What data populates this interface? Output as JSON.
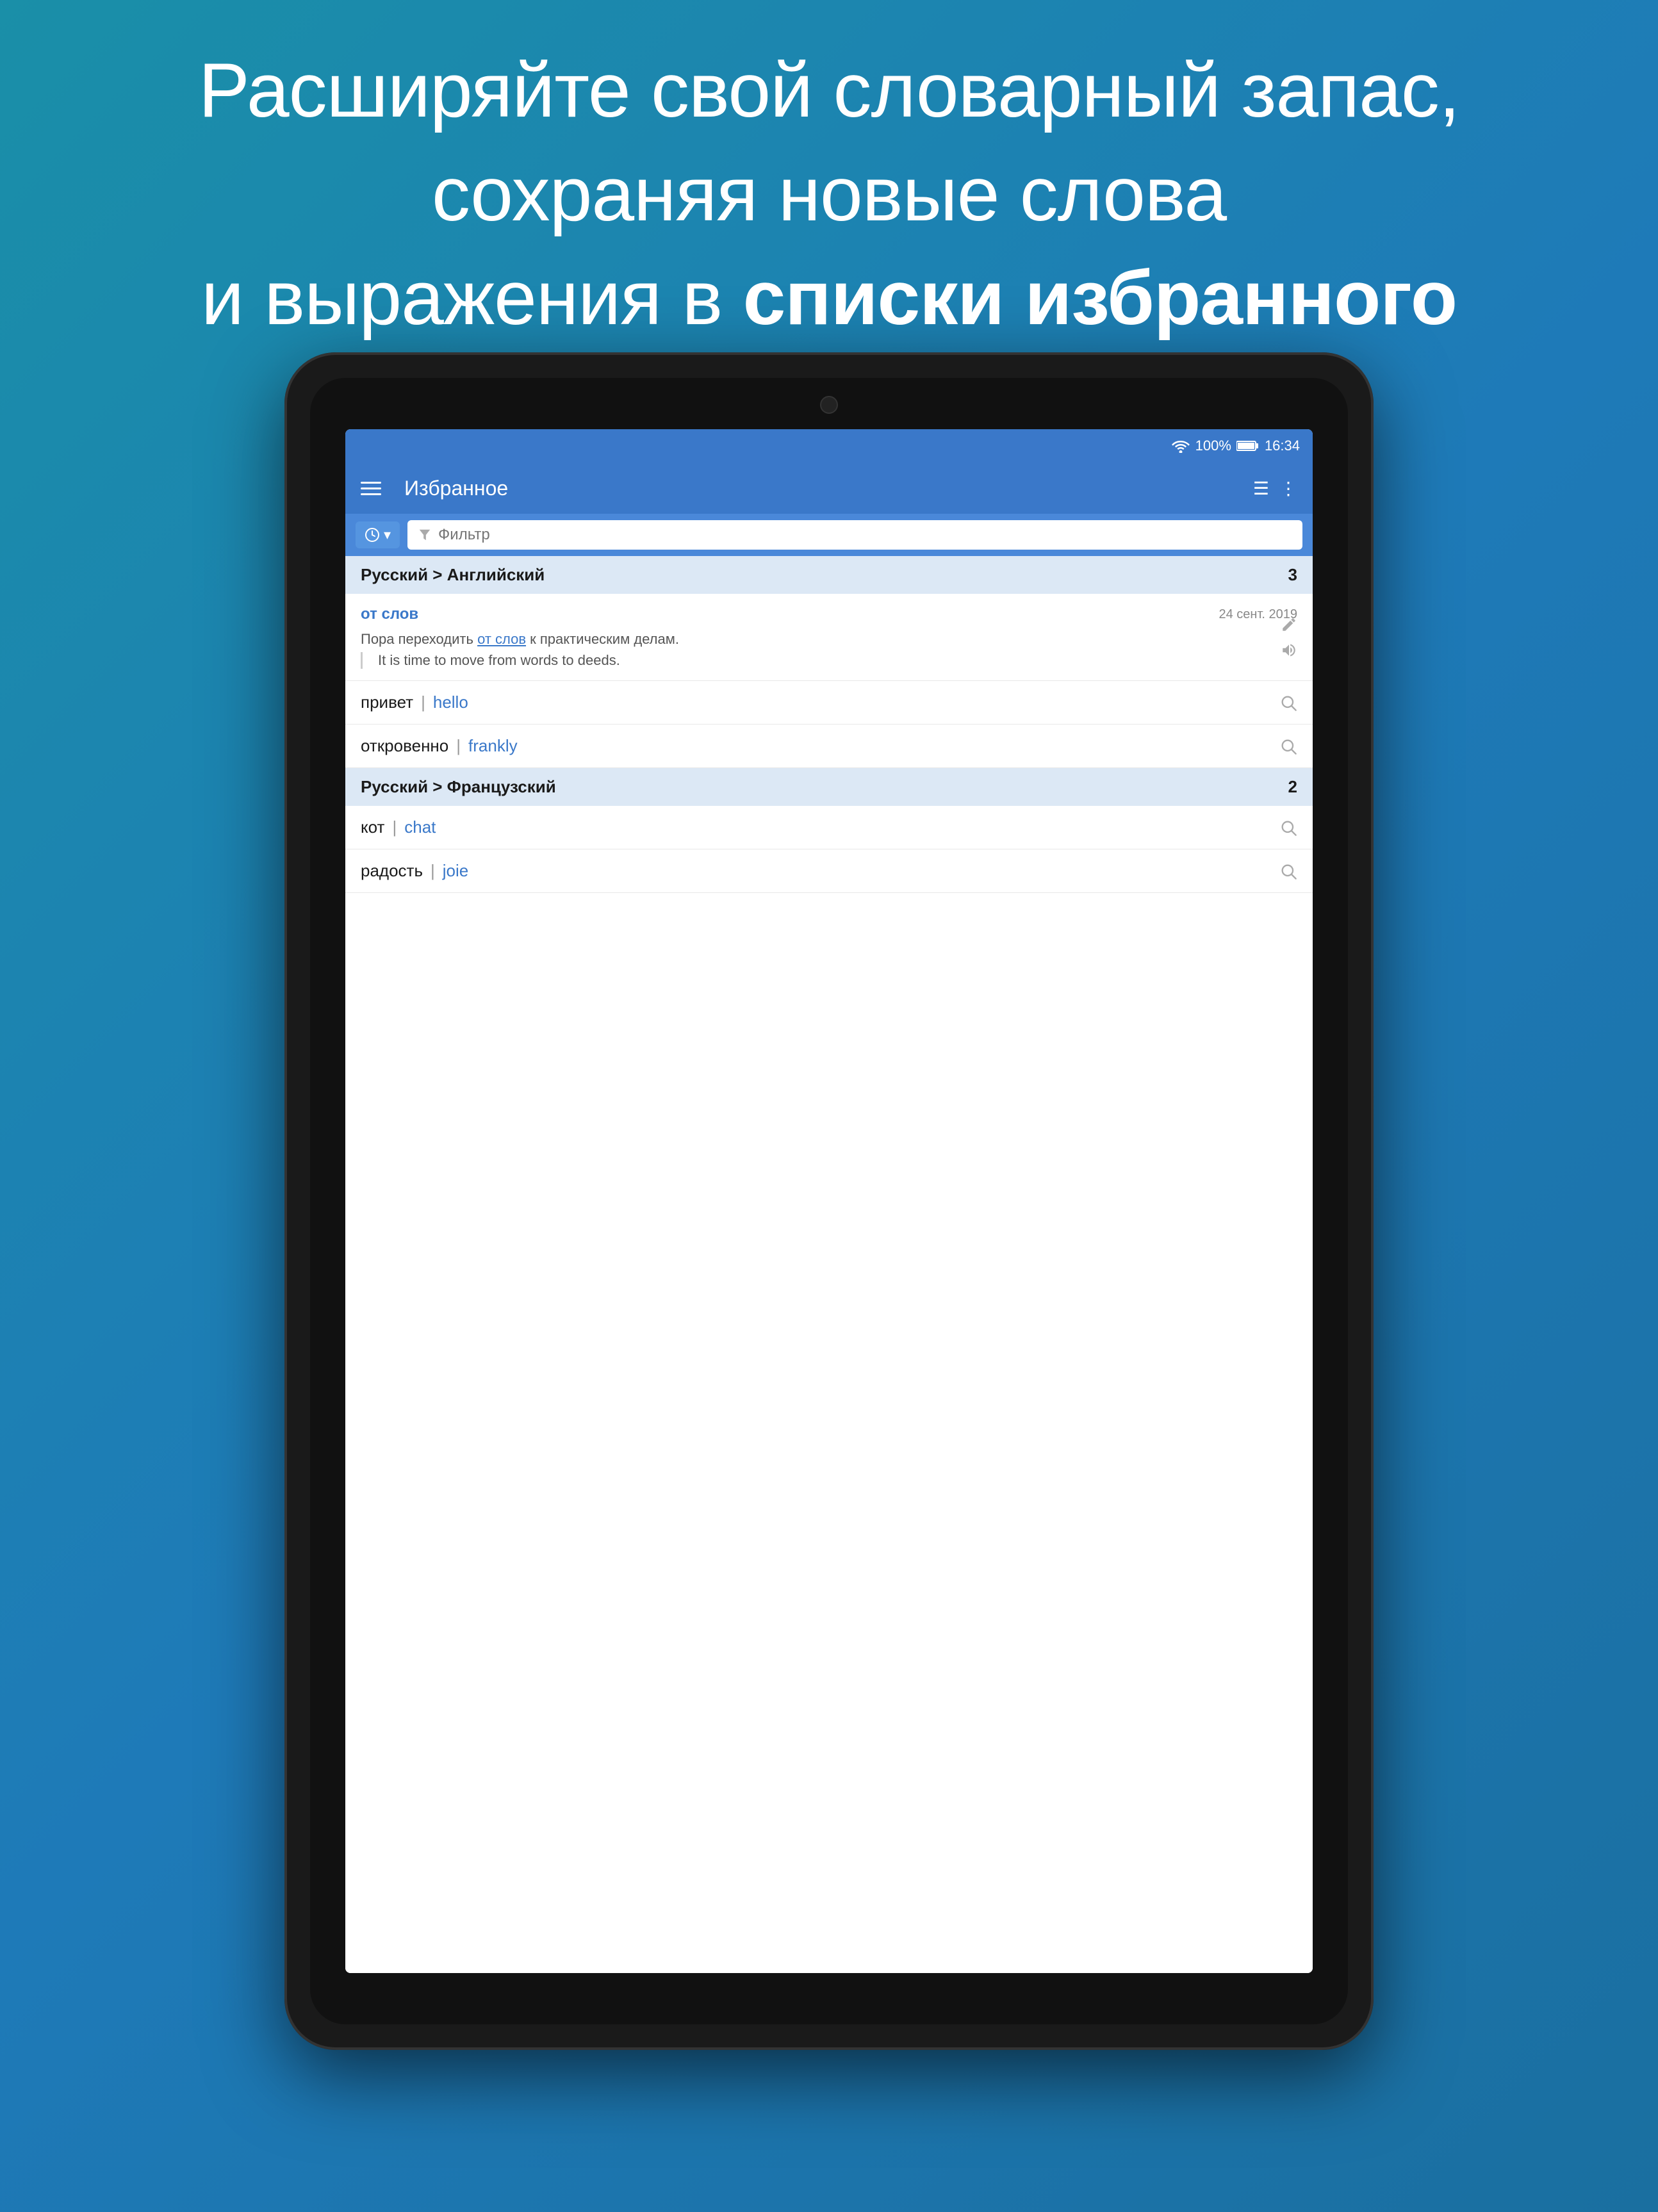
{
  "header": {
    "line1": "Расширяйте свой словарный запас,",
    "line2": "сохраняя новые слова",
    "line3_normal": "и выражения в ",
    "line3_bold": "списки избранного"
  },
  "status_bar": {
    "wifi": "WiFi",
    "battery": "100%",
    "time": "16:34"
  },
  "app_bar": {
    "title": "Избранное",
    "menu_icon": "☰",
    "list_icon": "≡",
    "more_icon": "⋮"
  },
  "filter_bar": {
    "time_btn": "🕐 ▾",
    "filter_placeholder": "Фильтр"
  },
  "sections": [
    {
      "id": "section-ru-en",
      "title": "Русский > Английский",
      "count": "3",
      "items": [
        {
          "type": "phrase",
          "source_text": "от слов",
          "date": "24 сент. 2019",
          "phrase": "Пора переходить от слов к практическим делам.",
          "phrase_highlight": "от слов",
          "translation": "↳  It is time to move from words to deeds.",
          "icons": [
            "edit",
            "sound"
          ]
        },
        {
          "type": "word",
          "source": "привет",
          "divider": "|",
          "translation": "hello"
        },
        {
          "type": "word",
          "source": "откровенно",
          "divider": "|",
          "translation": "frankly"
        }
      ]
    },
    {
      "id": "section-ru-fr",
      "title": "Русский > Французский",
      "count": "2",
      "items": [
        {
          "type": "word",
          "source": "кот",
          "divider": "|",
          "translation": "chat"
        },
        {
          "type": "word",
          "source": "радость",
          "divider": "|",
          "translation": "joie"
        }
      ]
    }
  ]
}
